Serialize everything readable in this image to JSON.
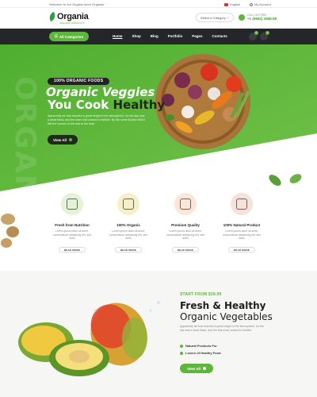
{
  "topbar": {
    "welcome": "Welcome to our Organic store Organia!",
    "language": "English",
    "account": "My Account"
  },
  "header": {
    "logo_name": "Organia",
    "logo_sub": "ORGANIC PRODUCTS",
    "category_select": "Select a Category",
    "call_label": "CALL US FREE",
    "phone": "+1 (9682) 2568-88"
  },
  "nav": {
    "all_categories": "All Categories",
    "links": [
      "Home",
      "Shop",
      "Blog",
      "Portfolio",
      "Pages",
      "Contacts"
    ],
    "cart_count": "0",
    "wishlist_count": "0"
  },
  "hero": {
    "watermark": "ORGAN",
    "tag": "100% ORGANIC FOODS",
    "title_line1": "Organic Veggies",
    "title_line2a": "You Cook",
    "title_line2b": "Healthy",
    "text": "Apparently we had reached a great height in the atmosphere, for the sky was a dead black, and the stars had ceased to twinkle. By the same illusion which lifts the horizon of the sea to the level",
    "button": "View All"
  },
  "features": [
    {
      "title": "Fresh from Nutrition",
      "desc": "Lorem ipsum dolor sit amet, consectetuer adipiscing elit, sed diam",
      "button": "READ MORE",
      "color": "#e4f3d6"
    },
    {
      "title": "100% Organic",
      "desc": "Lorem ipsum dolor sit amet, consectetuer adipiscing elit, sed diam",
      "button": "READ MORE",
      "color": "#f7efc7"
    },
    {
      "title": "Premium Quality",
      "desc": "Lorem ipsum dolor sit amet, consectetuer adipiscing elit, sed diam",
      "button": "READ MORE",
      "color": "#fbe6d8"
    },
    {
      "title": "100% Natural Product",
      "desc": "Lorem ipsum dolor sit amet, consectetuer adipiscing elit, sed diam",
      "button": "READ MORE",
      "color": "#f6e1db"
    }
  ],
  "product": {
    "start_from": "START FROM $39.99",
    "title1": "Fresh & Healthy",
    "title2": "Organic Vegetables",
    "text": "Apparently we had reached a great height in the atmosphere, for the sky was a dead black, and the stars had ceased to twinkle.",
    "bullet1": "Natural Products For",
    "bullet2": "Lovers of Healthy Food.",
    "button": "View All"
  },
  "colors": {
    "brand_green": "#5eb63c",
    "dark_nav": "#24262a"
  }
}
